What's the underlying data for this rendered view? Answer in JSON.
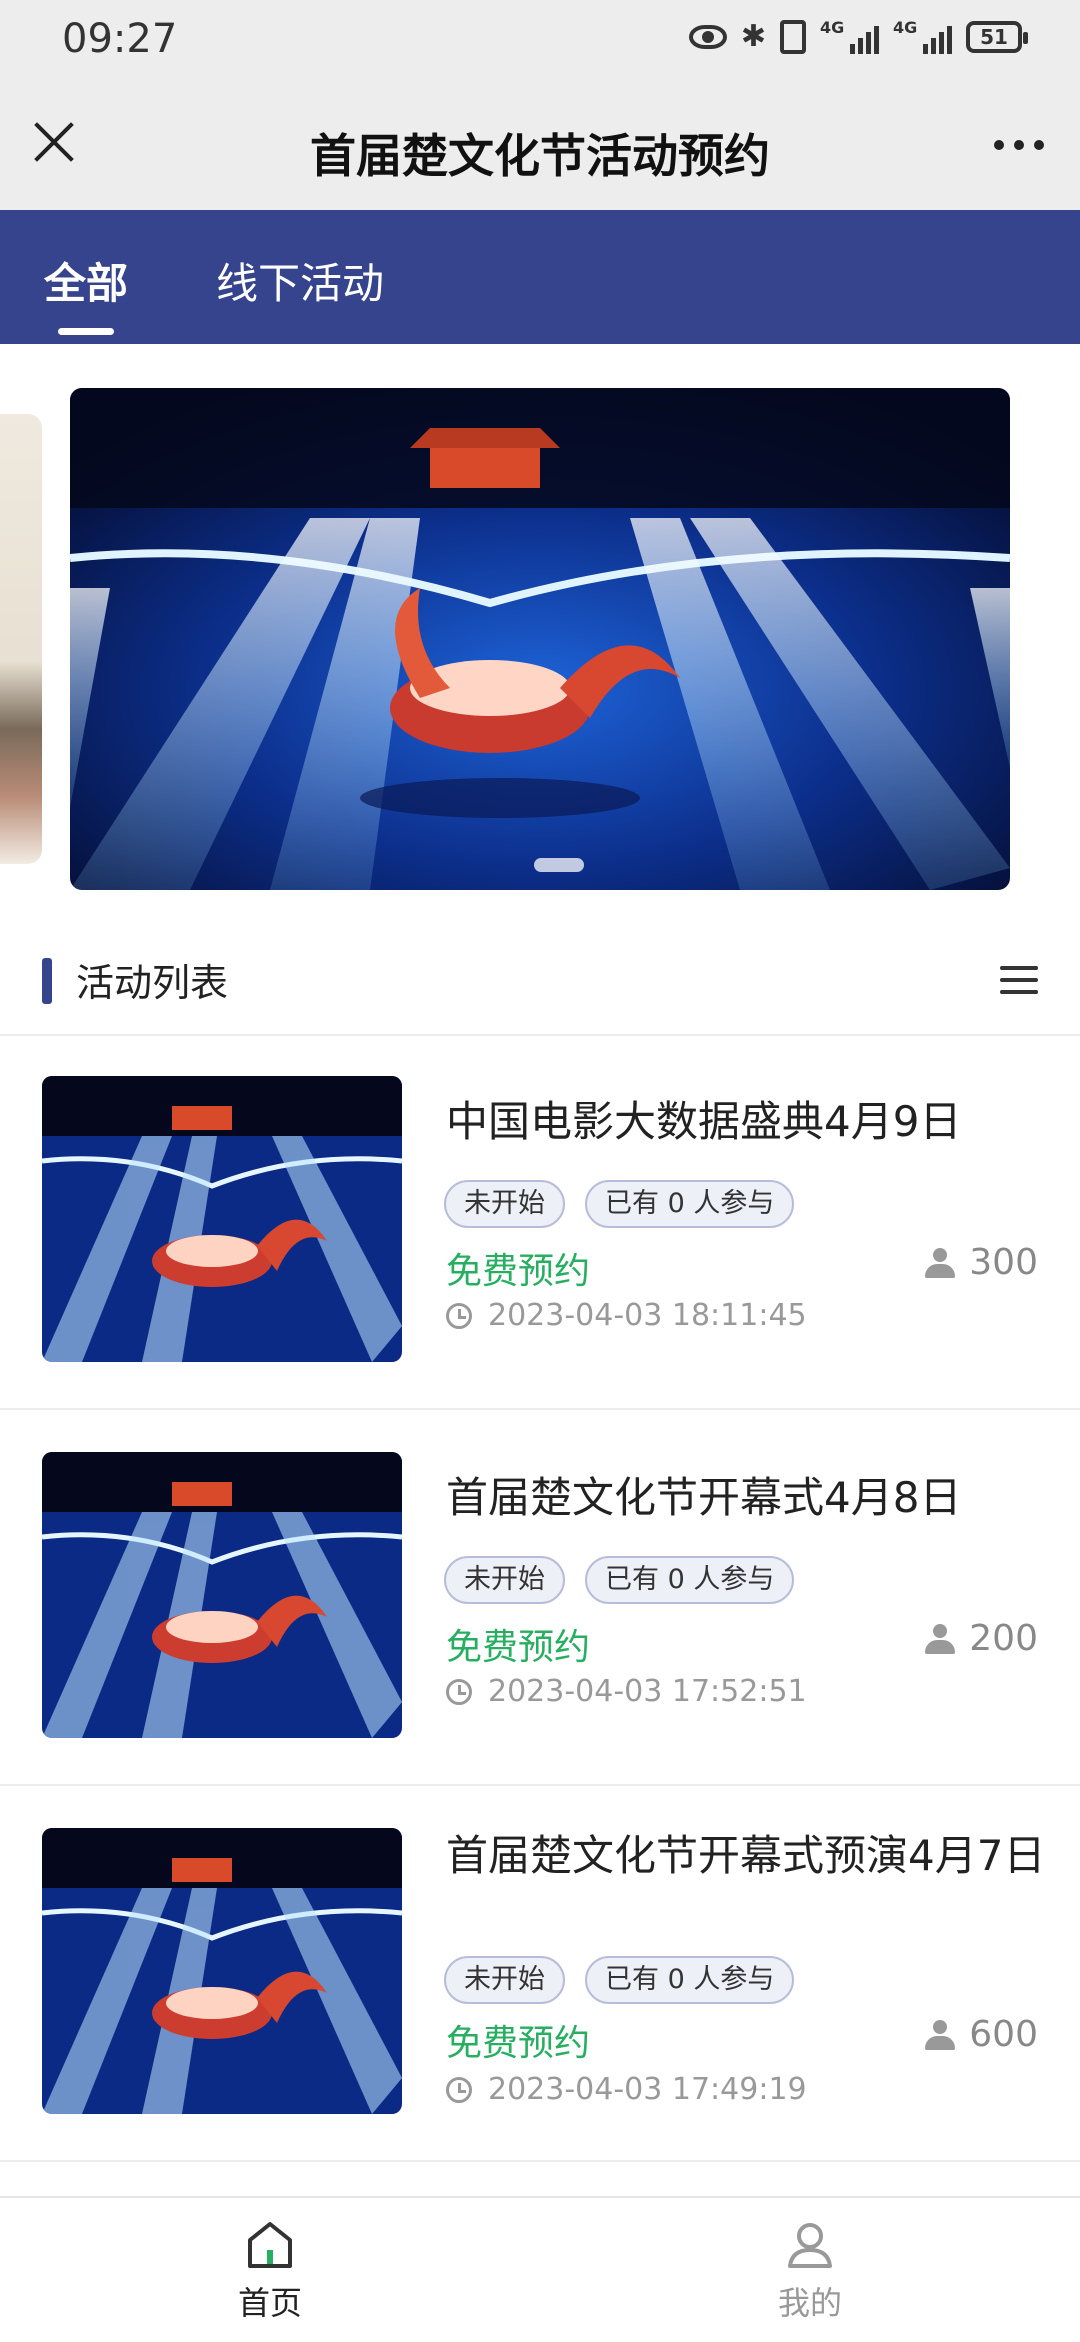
{
  "status_bar": {
    "time": "09:27",
    "battery": "51"
  },
  "nav": {
    "title": "首届楚文化节活动预约"
  },
  "tabs": [
    {
      "label": "全部",
      "active": true
    },
    {
      "label": "线下活动",
      "active": false
    }
  ],
  "section": {
    "title": "活动列表"
  },
  "activities": [
    {
      "name": "中国电影大数据盛典4月9日",
      "status": "未开始",
      "joined": "已有 0 人参与",
      "price": "免费预约",
      "capacity": "300",
      "time": "2023-04-03 18:11:45"
    },
    {
      "name": "首届楚文化节开幕式4月8日",
      "status": "未开始",
      "joined": "已有 0 人参与",
      "price": "免费预约",
      "capacity": "200",
      "time": "2023-04-03 17:52:51"
    },
    {
      "name": "首届楚文化节开幕式预演4月7日",
      "status": "未开始",
      "joined": "已有 0 人参与",
      "price": "免费预约",
      "capacity": "600",
      "time": "2023-04-03 17:49:19"
    }
  ],
  "bottom_nav": [
    {
      "label": "首页",
      "icon": "home-icon",
      "active": true
    },
    {
      "label": "我的",
      "icon": "user-icon",
      "active": false
    }
  ],
  "colors": {
    "primary": "#36448d",
    "free": "#27ae60"
  }
}
